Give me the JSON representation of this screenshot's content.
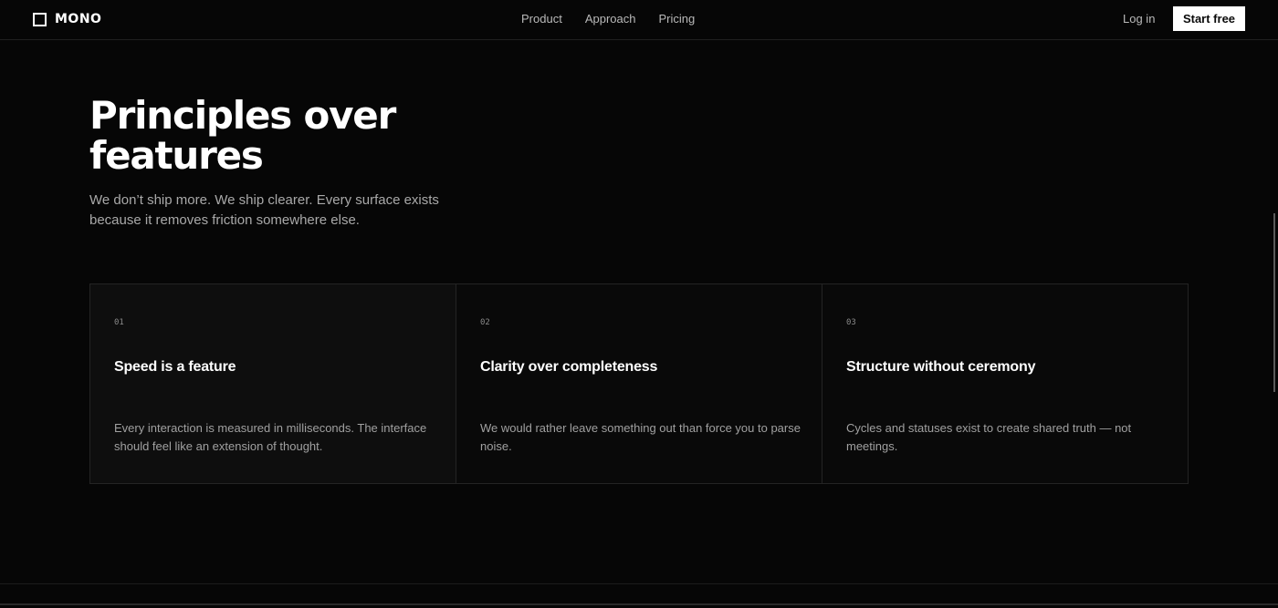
{
  "header": {
    "logo_text": "MONO",
    "nav": [
      "Product",
      "Approach",
      "Pricing"
    ],
    "login_label": "Log in",
    "cta_label": "Start free"
  },
  "hero": {
    "title_line1": "Principles over",
    "title_line2": "features",
    "subtitle": "We don’t ship more. We ship clearer. Every surface exists because it removes friction somewhere else."
  },
  "principles": [
    {
      "number": "01",
      "title": "Speed is a feature",
      "body": "Every interaction is measured in milliseconds. The interface should feel like an extension of thought."
    },
    {
      "number": "02",
      "title": "Clarity over completeness",
      "body": "We would rather leave something out than force you to parse noise."
    },
    {
      "number": "03",
      "title": "Structure without ceremony",
      "body": "Cycles and statuses exist to create shared truth — not meetings."
    }
  ],
  "colors": {
    "background": "#060606",
    "text": "#ffffff",
    "muted": "#a9a9a9",
    "border": "#242424",
    "button_bg": "#ffffff"
  }
}
